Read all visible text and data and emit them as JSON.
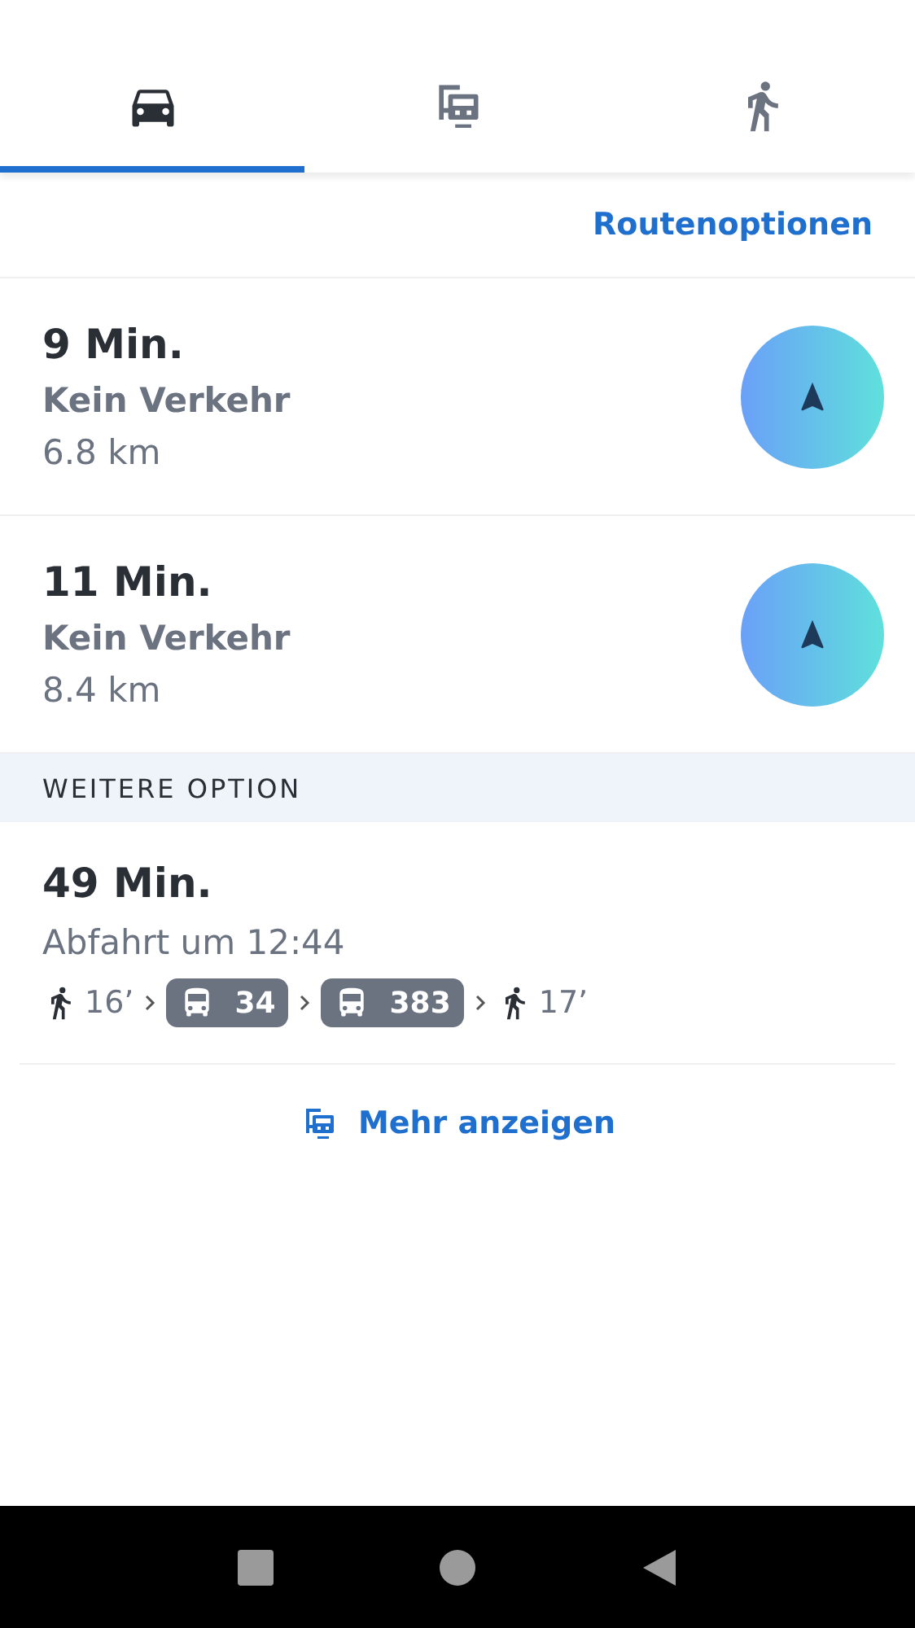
{
  "tabs": [
    {
      "kind": "car",
      "selected": true
    },
    {
      "kind": "transit",
      "selected": false
    },
    {
      "kind": "walk",
      "selected": false
    }
  ],
  "route_options_link": "Routenoptionen",
  "routes": [
    {
      "duration": "9 Min.",
      "traffic": "Kein Verkehr",
      "distance": "6.8 km"
    },
    {
      "duration": "11 Min.",
      "traffic": "Kein Verkehr",
      "distance": "8.4 km"
    }
  ],
  "section_header": "WEITERE OPTION",
  "transit_route": {
    "duration": "49 Min.",
    "departure": "Abfahrt um 12:44",
    "legs": [
      {
        "kind": "walk",
        "text": "16’"
      },
      {
        "kind": "bus",
        "text": "34"
      },
      {
        "kind": "bus",
        "text": "383"
      },
      {
        "kind": "walk",
        "text": "17’"
      }
    ]
  },
  "show_more": "Mehr anzeigen"
}
